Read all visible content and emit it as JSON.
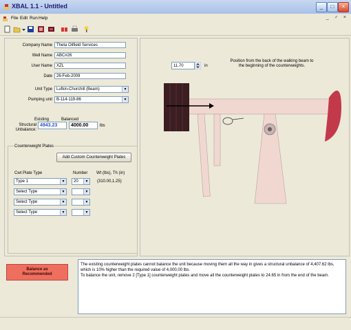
{
  "window": {
    "title": "XBAL 1.1 - Untitled",
    "minimize": "_",
    "maximize": "□",
    "close": "×"
  },
  "menu": {
    "items": [
      "File",
      "Edit",
      "Run",
      "Help"
    ],
    "mdi": "_ ♂ ×"
  },
  "toolbar": {
    "icons": [
      "new-icon",
      "open-icon",
      "save-icon",
      "report-icon",
      "unit-icon",
      "plates-icon",
      "print-icon",
      "help-icon"
    ]
  },
  "form": {
    "company_label": "Company Name",
    "company_value": "Theta Oilfield Services",
    "well_label": "Well Name",
    "well_value": "ABC#26",
    "user_label": "User Name",
    "user_value": "XZL",
    "date_label": "Date",
    "date_value": "26-Feb-2009",
    "unit_type_label": "Unit Type",
    "unit_type_value": "Lufkin-Churchill (Beam)",
    "pumping_unit_label": "Pumping unit",
    "pumping_unit_value": "B-114-119-86",
    "existing_label": "Existing",
    "balanced_label": "Balanced",
    "structural_label_1": "Structural",
    "structural_label_2": "Unbalance:",
    "existing_value": "4943.23",
    "balanced_value": "4000.00",
    "unit_lbs": "lbs"
  },
  "plates": {
    "group_title": "Counterweight Plates",
    "add_custom_label": "Add Custom Counterweight Plates",
    "col_type": "Cwt Plate Type",
    "col_number": "Number",
    "col_wt": "Wt (lbs), Th (in)",
    "rows": [
      {
        "type": "Type 1",
        "number": "20",
        "info": "(310.00,1.25)"
      },
      {
        "type": "Select Type",
        "number": "",
        "info": ""
      },
      {
        "type": "Select Type",
        "number": "",
        "info": ""
      },
      {
        "type": "Select Type",
        "number": "",
        "info": ""
      }
    ]
  },
  "diagram": {
    "position_value": "11.70",
    "position_unit": "in",
    "caption_1": "Position from the back of the walking beam to",
    "caption_2": "the beginning of the counterweights."
  },
  "bottom": {
    "balance_label_1": "Balance as",
    "balance_label_2": "Recommended",
    "message_1": "The existing counterweight plates cannot balance the unit because moving them all the way in gives a structural unbalance of 4,407.62 lbs, which is 10% higher than the required value of 4,000.00 lbs.",
    "message_2": "To balance the unit, remove 2 [Type 1] counterweight plates and move all the counterweight plates to 24.65 in from the end of the beam."
  },
  "colors": {
    "accent": "#2a55c4",
    "balance_button": "#ef6f5f",
    "beam": "#f0d8d0",
    "counterweight": "#3a1e22",
    "horsehead": "#c23a4a"
  }
}
